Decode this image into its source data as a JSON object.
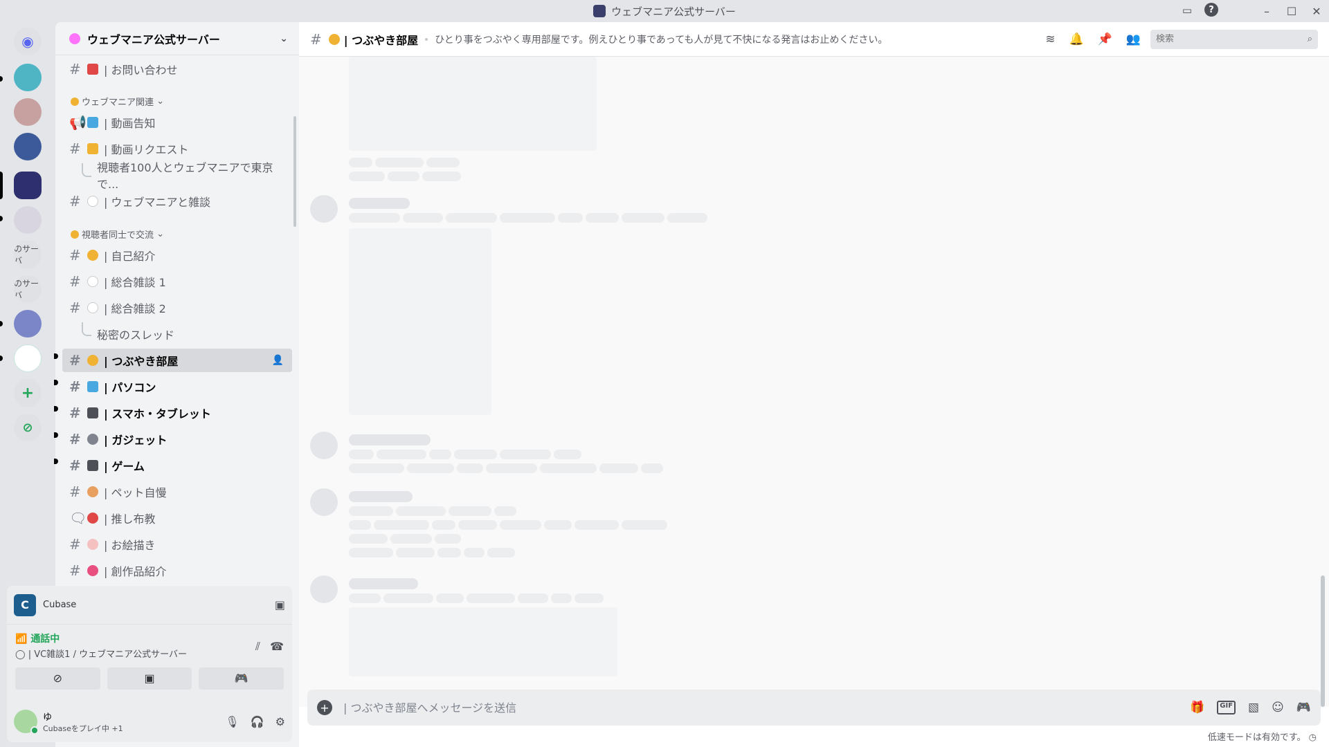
{
  "window": {
    "title": "ウェブマニア公式サーバー"
  },
  "guilds": {
    "items": [
      {
        "label": "ウェブマニア公式サーバー",
        "text": ""
      },
      {
        "label": "server-2",
        "text": ""
      },
      {
        "label": "server-3",
        "text": ""
      },
      {
        "label": "server-4",
        "text": ""
      },
      {
        "label": "server-5",
        "text": ""
      },
      {
        "label": "server-6",
        "text": "のサーバ"
      },
      {
        "label": "server-7",
        "text": "のサーバ"
      },
      {
        "label": "server-8",
        "text": ""
      },
      {
        "label": "server-9",
        "text": ""
      }
    ]
  },
  "sidebar": {
    "server_name": "ウェブマニア公式サーバー",
    "categories": {
      "webmania": "ウェブマニア関連",
      "viewers": "視聴者同士で交流"
    },
    "channels": {
      "inquiry": "| お問い合わせ",
      "video_notice": "| 動画告知",
      "video_request": "| 動画リクエスト",
      "thread_100": "視聴者100人とウェブマニアで東京で...",
      "webmania_chat": "| ウェブマニアと雑談",
      "intro": "| 自己紹介",
      "chat1": "| 総合雑談 1",
      "chat2": "| 総合雑談 2",
      "secret_thread": "秘密のスレッド",
      "tsubuyaki": "| つぶやき部屋",
      "pc": "| パソコン",
      "smartphone": "| スマホ・タブレット",
      "gadget": "| ガジェット",
      "game": "| ゲーム",
      "pet": "| ペット自慢",
      "oshi": "| 推し布教",
      "drawing": "| お絵描き",
      "creation": "| 創作品紹介"
    }
  },
  "panel": {
    "activity_name": "Cubase",
    "voice_status": "通話中",
    "voice_location": "| VC雑談1 / ウェブマニア公式サーバー",
    "user_name": "ゆ",
    "user_status": "Cubaseをプレイ中 +1"
  },
  "chat": {
    "channel_name": "| つぶやき部屋",
    "topic": "ひとり事をつぶやく専用部屋です。例えひとり事であっても人が見て不快になる発言はお止めください。",
    "search_placeholder": "検索",
    "composer_placeholder": "| つぶやき部屋へメッセージを送信",
    "slowmode": "低速モードは有効です。"
  },
  "colors": {
    "accent": "#5865f2",
    "online": "#23a55a",
    "background": "#f9f9fa"
  }
}
